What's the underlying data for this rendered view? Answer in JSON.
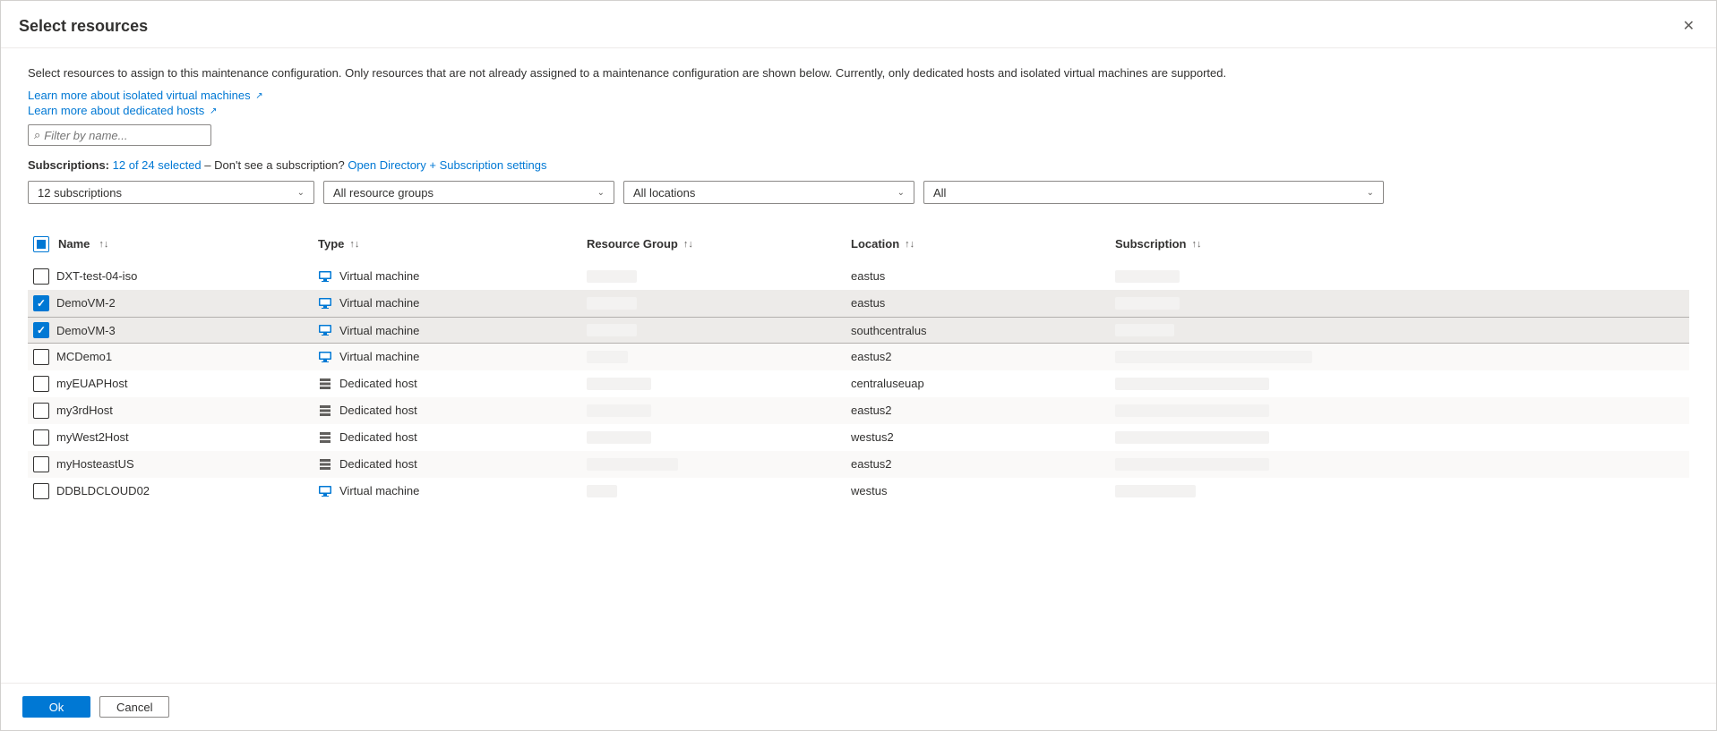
{
  "header": {
    "title": "Select resources"
  },
  "description": "Select resources to assign to this maintenance configuration. Only resources that are not already assigned to a maintenance configuration are shown below. Currently, only dedicated hosts and isolated virtual machines are supported.",
  "links": {
    "isolated_vms": "Learn more about isolated virtual machines",
    "dedicated_hosts": "Learn more about dedicated hosts"
  },
  "filter": {
    "placeholder": "Filter by name..."
  },
  "subscriptions": {
    "label": "Subscriptions:",
    "selected_text": "12 of 24 selected",
    "separator": "– Don't see a subscription?",
    "settings_link": "Open Directory + Subscription settings"
  },
  "dropdowns": {
    "subs": "12 subscriptions",
    "rg": "All resource groups",
    "loc": "All locations",
    "all": "All"
  },
  "columns": {
    "name": "Name",
    "type": "Type",
    "rg": "Resource Group",
    "location": "Location",
    "subscription": "Subscription"
  },
  "type_labels": {
    "vm": "Virtual machine",
    "host": "Dedicated host"
  },
  "rows": [
    {
      "name": "DXT-test-04-iso",
      "type": "vm",
      "location": "eastus",
      "checked": false,
      "rg_w": 56,
      "sub_w": 72
    },
    {
      "name": "DemoVM-2",
      "type": "vm",
      "location": "eastus",
      "checked": true,
      "rg_w": 56,
      "sub_w": 72
    },
    {
      "name": "DemoVM-3",
      "type": "vm",
      "location": "southcentralus",
      "checked": true,
      "rg_w": 56,
      "sub_w": 66,
      "highlighted": true
    },
    {
      "name": "MCDemo1",
      "type": "vm",
      "location": "eastus2",
      "checked": false,
      "rg_w": 46,
      "sub_w": 220
    },
    {
      "name": "myEUAPHost",
      "type": "host",
      "location": "centraluseuap",
      "checked": false,
      "rg_w": 72,
      "sub_w": 172
    },
    {
      "name": "my3rdHost",
      "type": "host",
      "location": "eastus2",
      "checked": false,
      "rg_w": 72,
      "sub_w": 172
    },
    {
      "name": "myWest2Host",
      "type": "host",
      "location": "westus2",
      "checked": false,
      "rg_w": 72,
      "sub_w": 172
    },
    {
      "name": "myHosteastUS",
      "type": "host",
      "location": "eastus2",
      "checked": false,
      "rg_w": 102,
      "sub_w": 172
    },
    {
      "name": "DDBLDCLOUD02",
      "type": "vm",
      "location": "westus",
      "checked": false,
      "rg_w": 34,
      "sub_w": 90
    }
  ],
  "footer": {
    "ok": "Ok",
    "cancel": "Cancel"
  }
}
